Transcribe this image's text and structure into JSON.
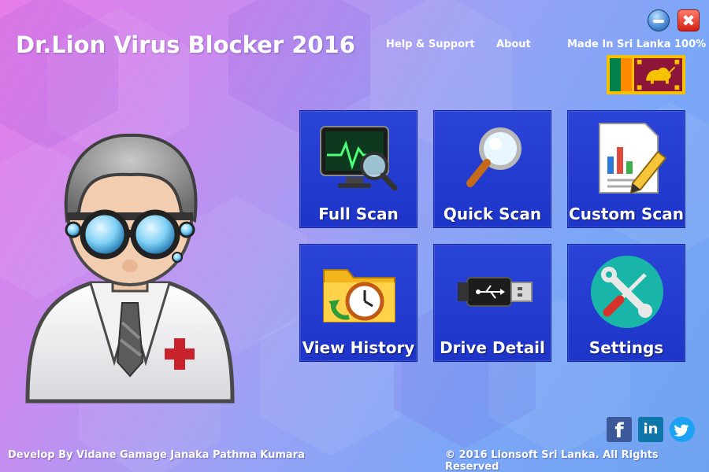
{
  "app": {
    "title": "Dr.Lion Virus Blocker 2016"
  },
  "header": {
    "help_label": "Help & Support",
    "about_label": "About",
    "made_in_label": "Made In Sri Lanka 100%"
  },
  "window_controls": {
    "close_glyph": "✖"
  },
  "tiles": [
    {
      "label": "Full Scan",
      "icon": "monitor-magnifier-icon"
    },
    {
      "label": "Quick Scan",
      "icon": "magnifier-icon"
    },
    {
      "label": "Custom Scan",
      "icon": "report-pencil-icon"
    },
    {
      "label": "View History",
      "icon": "folder-clock-icon"
    },
    {
      "label": "Drive Detail",
      "icon": "usb-drive-icon"
    },
    {
      "label": "Settings",
      "icon": "wrench-screwdriver-icon"
    }
  ],
  "social": {
    "facebook_glyph": "f",
    "linkedin_glyph": "in"
  },
  "footer": {
    "developer": "Develop By Vidane Gamage Janaka Pathma Kumara",
    "copyright": "© 2016 Lionsoft Sri Lanka. All Rights Reserved"
  },
  "colors": {
    "tile_blue": "#1f37cc",
    "flag_border": "#f6c200",
    "flag_maroon": "#8d153a",
    "close_red": "#d21f12"
  }
}
